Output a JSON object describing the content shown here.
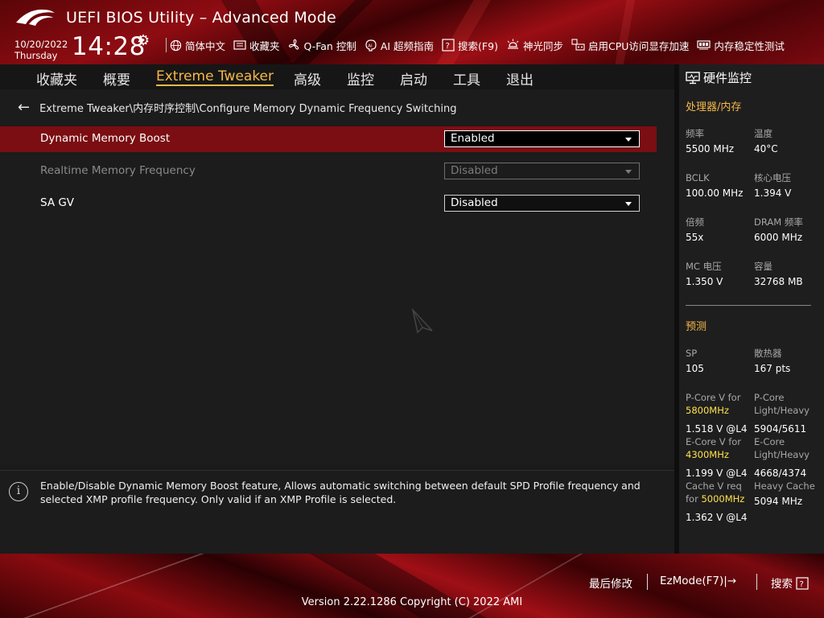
{
  "header": {
    "title": "UEFI BIOS Utility – Advanced Mode",
    "date": "10/20/2022",
    "weekday": "Thursday",
    "time": "14:28",
    "toolbar": [
      {
        "label": "简体中文",
        "icon": "globe-icon"
      },
      {
        "label": "收藏夹",
        "icon": "favorites-icon"
      },
      {
        "label": "Q-Fan 控制",
        "icon": "fan-icon"
      },
      {
        "label": "AI 超频指南",
        "icon": "ai-icon"
      },
      {
        "label": "搜索(F9)",
        "icon": "search-help-icon"
      },
      {
        "label": "神光同步",
        "icon": "aura-icon"
      },
      {
        "label": "启用CPU访问显存加速",
        "icon": "resizable-bar-icon"
      },
      {
        "label": "内存稳定性测试",
        "icon": "memory-test-icon"
      }
    ]
  },
  "nav": {
    "tabs": [
      {
        "label": "收藏夹",
        "active": false
      },
      {
        "label": "概要",
        "active": false
      },
      {
        "label": "Extreme Tweaker",
        "active": true
      },
      {
        "label": "高级",
        "active": false
      },
      {
        "label": "监控",
        "active": false
      },
      {
        "label": "启动",
        "active": false
      },
      {
        "label": "工具",
        "active": false
      },
      {
        "label": "退出",
        "active": false
      }
    ]
  },
  "breadcrumb": "Extreme Tweaker\\内存时序控制\\Configure Memory Dynamic Frequency Switching",
  "settings": [
    {
      "label": "Dynamic Memory Boost",
      "value": "Enabled",
      "selected": true,
      "disabled": false
    },
    {
      "label": "Realtime Memory Frequency",
      "value": "Disabled",
      "selected": false,
      "disabled": true
    },
    {
      "label": "SA GV",
      "value": "Disabled",
      "selected": false,
      "disabled": false
    }
  ],
  "help": {
    "text": "Enable/Disable Dynamic Memory Boost feature, Allows automatic switching between default SPD Profile frequency and selected XMP profile frequency. Only valid if an XMP Profile is selected."
  },
  "hardware_monitor": {
    "title": "硬件监控",
    "cpu_section": "处理器/内存",
    "cpu": {
      "freq_label": "频率",
      "freq": "5500 MHz",
      "temp_label": "温度",
      "temp": "40°C",
      "bclk_label": "BCLK",
      "bclk": "100.00 MHz",
      "vcore_label": "核心电压",
      "vcore": "1.394 V",
      "ratio_label": "倍频",
      "ratio": "55x",
      "dram_freq_label": "DRAM 频率",
      "dram_freq": "6000 MHz",
      "mc_volt_label": "MC 电压",
      "mc_volt": "1.350 V",
      "capacity_label": "容量",
      "capacity": "32768 MB"
    },
    "predict_section": "预测",
    "predict": {
      "sp_label": "SP",
      "sp": "105",
      "cooler_label": "散热器",
      "cooler": "167 pts",
      "pcore_v_label": "P-Core V for",
      "pcore_v_freq": "5800MHz",
      "pcore_v": "1.518 V @L4",
      "pcore_lh_label_1": "P-Core",
      "pcore_lh_label_2": "Light/Heavy",
      "pcore_lh": "5904/5611",
      "ecore_v_label": "E-Core V for",
      "ecore_v_freq": "4300MHz",
      "ecore_v": "1.199 V @L4",
      "ecore_lh_label_1": "E-Core",
      "ecore_lh_label_2": "Light/Heavy",
      "ecore_lh": "4668/4374",
      "cache_v_label_1": "Cache V req",
      "cache_v_label_2": "for",
      "cache_v_freq": "5000MHz",
      "cache_v": "1.362 V @L4",
      "heavy_cache_label": "Heavy Cache",
      "heavy_cache": "5094 MHz"
    }
  },
  "footer": {
    "last_modified": "最后修改",
    "ez_mode": "EzMode(F7)|→",
    "search": "搜索",
    "version": "Version 2.22.1286 Copyright (C) 2022 AMI"
  },
  "colors": {
    "accent": "#f5b84a",
    "selected_row": "#7a0e12",
    "highlight_value": "#ffe14a"
  }
}
